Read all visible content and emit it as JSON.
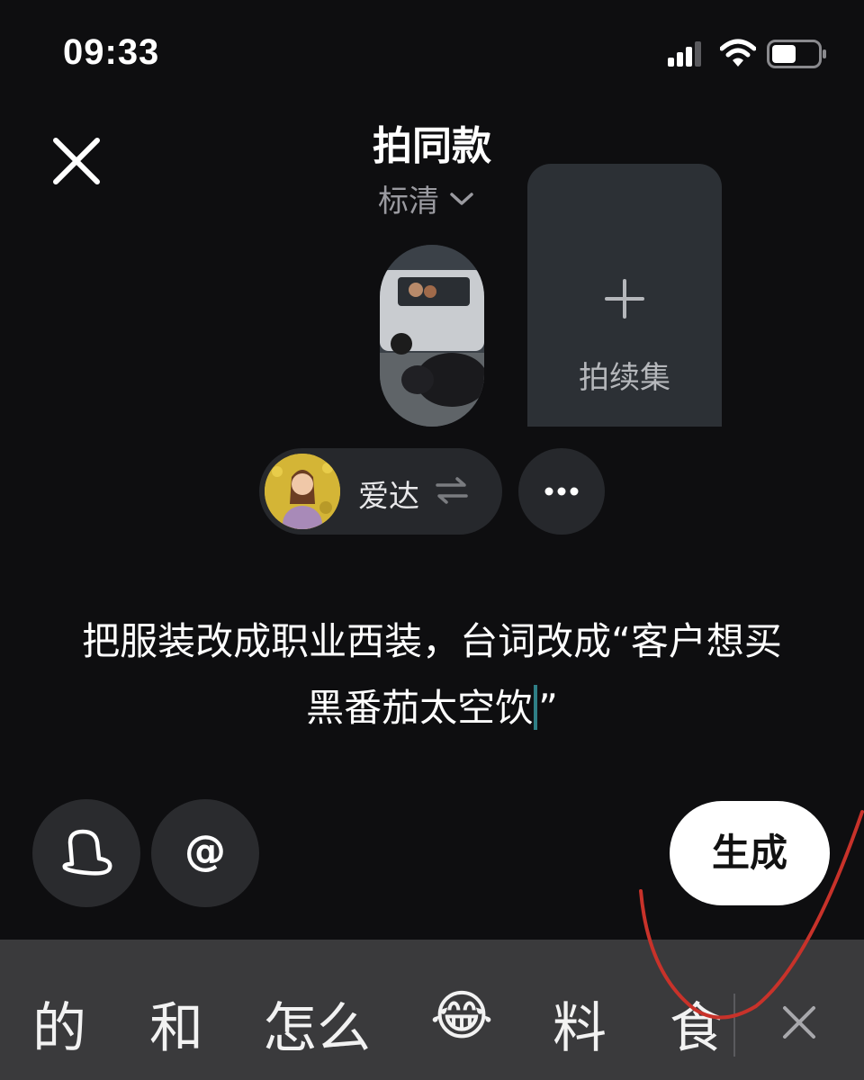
{
  "status_bar": {
    "time": "09:33"
  },
  "header": {
    "title": "拍同款",
    "quality": "标清"
  },
  "thumbnails": {
    "add_label": "拍续集"
  },
  "character": {
    "name": "爱达"
  },
  "prompt": {
    "line1": "把服装改成职业西装，台词改成“客户想买",
    "line2_before_cursor": "黑番茄太空饮",
    "line2_after_cursor": "”"
  },
  "actions": {
    "at_symbol": "@",
    "generate_label": "生成"
  },
  "suggestions": [
    "的",
    "和",
    "怎么",
    "😂",
    "料",
    "食"
  ],
  "colors": {
    "background": "#0e0e10",
    "card": "#2c3035",
    "chip": "#26282c",
    "generate_bg": "#ffffff",
    "caret": "#2f7f86",
    "annotation": "#c8322a",
    "suggest_bar": "#3a3a3c"
  },
  "icons": {
    "close": "close-icon",
    "quality_dropdown": "chevron-down-icon",
    "add": "plus-icon",
    "swap": "swap-arrows-icon",
    "more": "more-dots-icon",
    "character_hat": "hat-icon",
    "dismiss": "close-icon"
  }
}
